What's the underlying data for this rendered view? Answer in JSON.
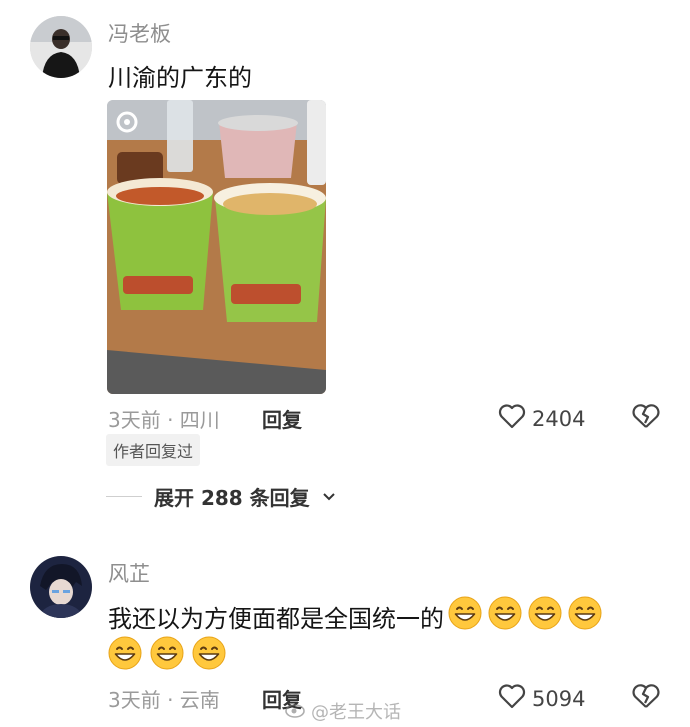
{
  "comments": [
    {
      "author": "冯老板",
      "text": "川渝的广东的",
      "meta": "3天前 · 四川",
      "reply_label": "回复",
      "likes": "2404",
      "author_tag": "作者回复过",
      "expand_label": "展开 288 条回复"
    },
    {
      "author": "风芷",
      "text": "我还以为方便面都是全国统一的",
      "meta": "3天前 · 云南",
      "reply_label": "回复",
      "likes": "5094"
    }
  ],
  "watermark": "@老王大话",
  "icons": {
    "like": "heart-outline-icon",
    "dislike": "broken-heart-icon",
    "expand": "chevron-down-icon",
    "emoji": "grinning-face-emoji"
  },
  "colors": {
    "meta": "#9a9a9a",
    "author": "#8e8e8e",
    "text": "#151515"
  }
}
